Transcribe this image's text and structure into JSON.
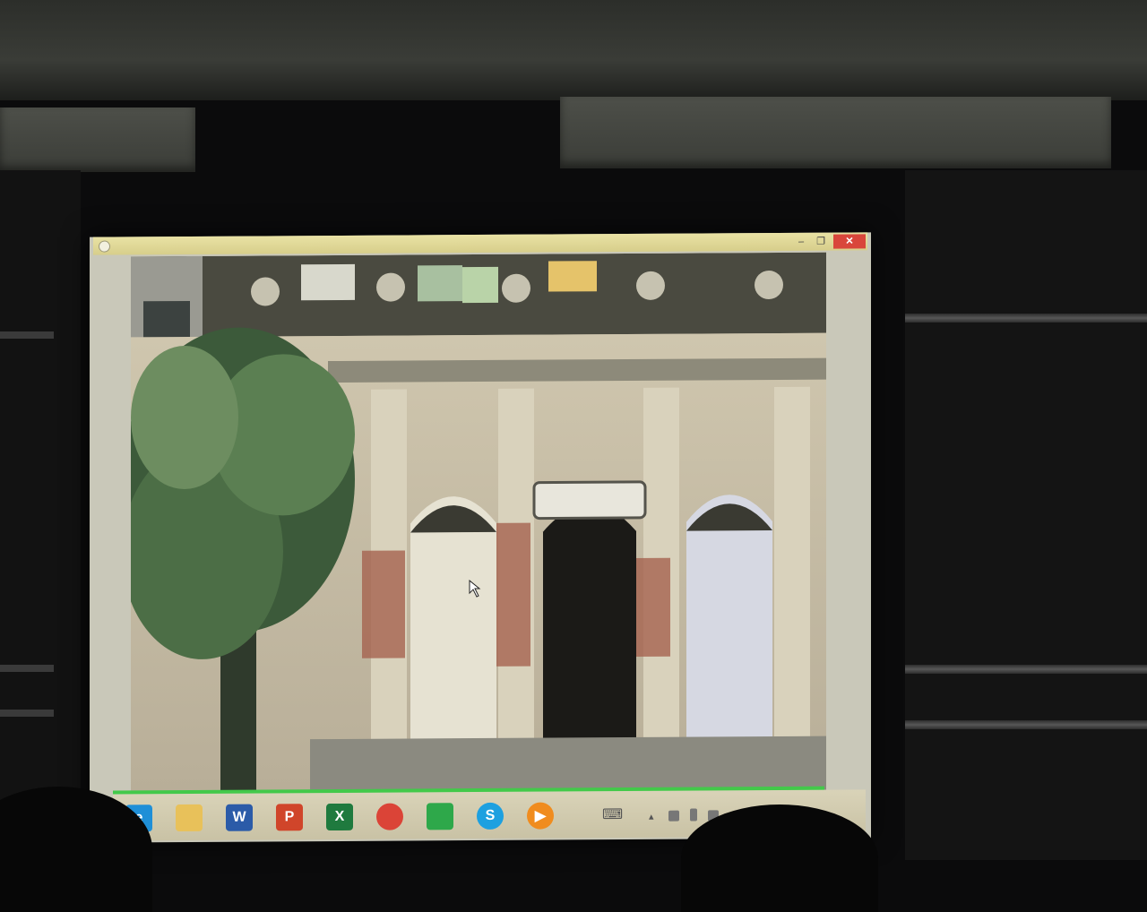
{
  "window": {
    "minimize_glyph": "–",
    "maximize_glyph": "❐",
    "close_glyph": "✕",
    "close_color": "#d9463b"
  },
  "content": {
    "image_subject": "weathered colonial building facade with arched doorways and a tree"
  },
  "taskbar": {
    "accent_color": "#43c94a",
    "pinned_apps": [
      {
        "name": "internet-explorer",
        "glyph": "e",
        "color": "#1f8fd7"
      },
      {
        "name": "file-explorer",
        "glyph": "",
        "color": "#e8c15a"
      },
      {
        "name": "word",
        "glyph": "W",
        "color": "#2b5ba8"
      },
      {
        "name": "powerpoint",
        "glyph": "P",
        "color": "#d0452a"
      },
      {
        "name": "excel",
        "glyph": "X",
        "color": "#1f7a3e"
      },
      {
        "name": "chrome",
        "glyph": "",
        "color": "#db4437"
      },
      {
        "name": "store",
        "glyph": "",
        "color": "#2ea84a"
      },
      {
        "name": "skype",
        "glyph": "S",
        "color": "#1da0e0"
      },
      {
        "name": "media-player",
        "glyph": "▶",
        "color": "#f08c1e"
      }
    ],
    "tray": {
      "keyboard_glyph": "⌨",
      "chevron_glyph": "▴"
    }
  }
}
